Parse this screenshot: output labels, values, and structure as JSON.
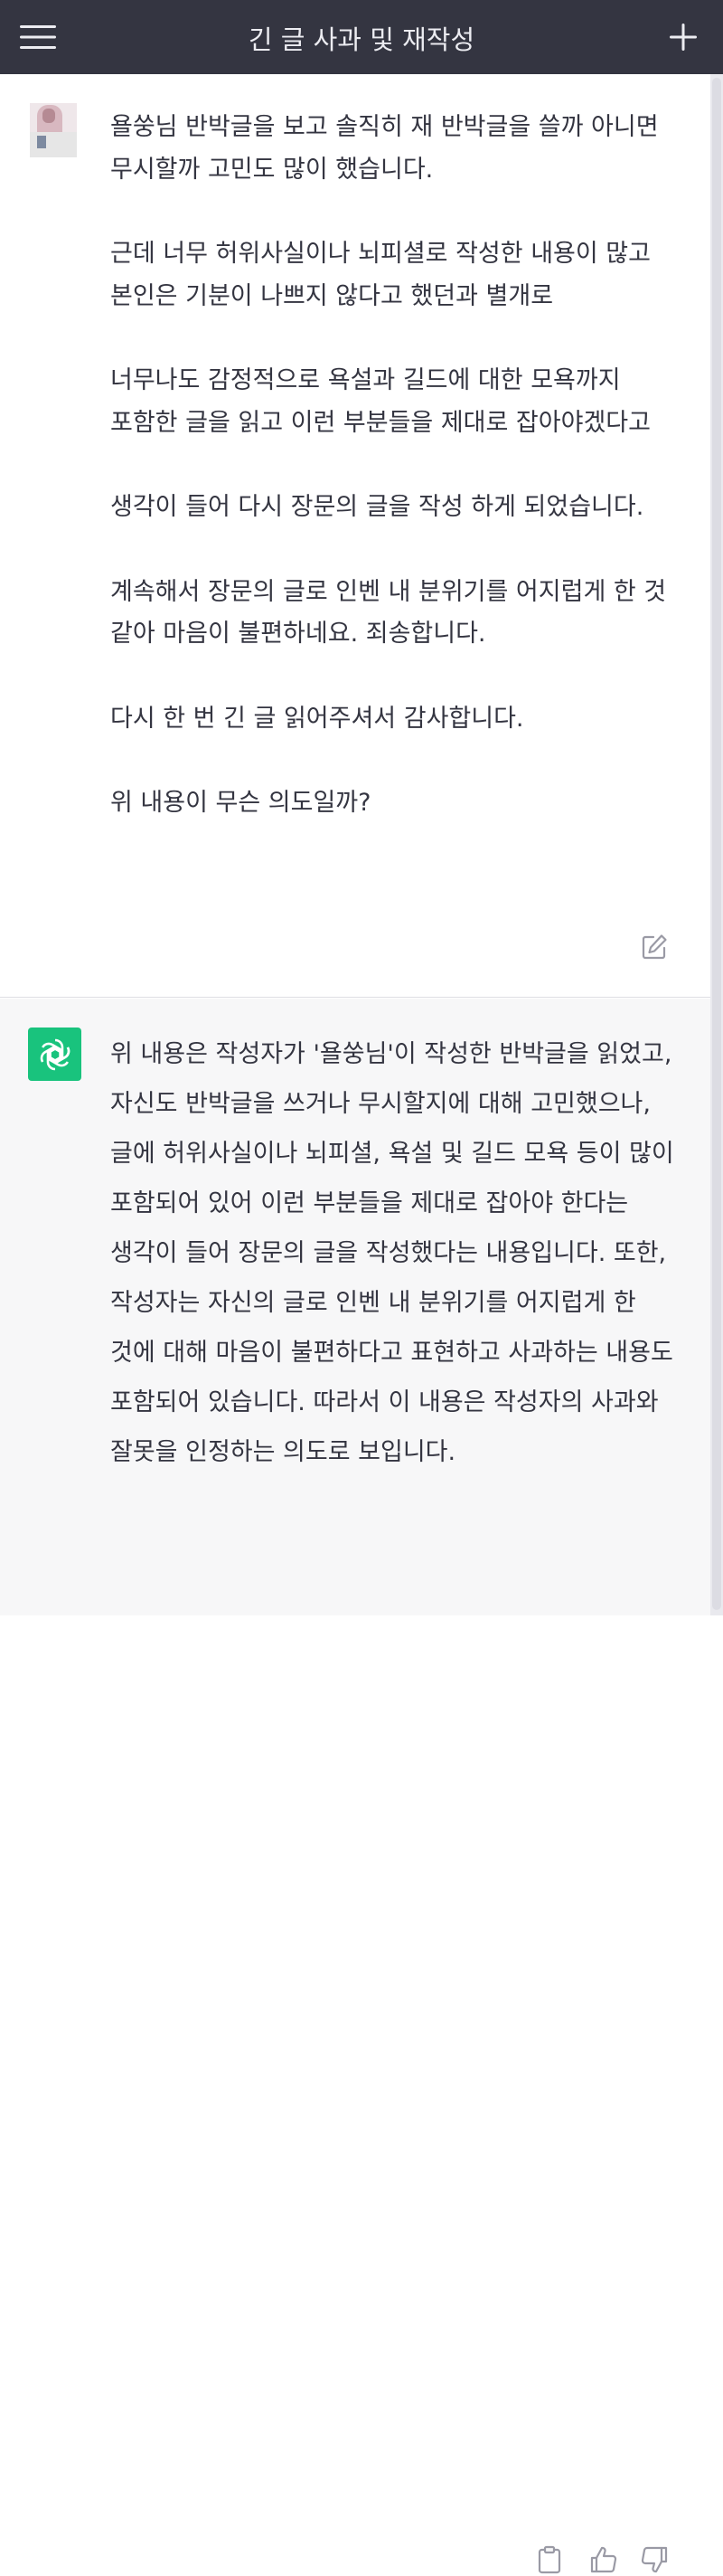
{
  "header": {
    "title": "긴 글 사과 및 재작성",
    "menu_icon": "hamburger-menu-icon",
    "new_chat_icon": "plus-icon"
  },
  "messages": [
    {
      "role": "user",
      "avatar": "user-avatar",
      "text": "욜쑹님 반박글을 보고 솔직히 재 반박글을 쓸까 아니면 무시할까 고민도 많이 했습니다.\n\n근데 너무 허위사실이나 뇌피셜로 작성한 내용이 많고 본인은 기분이 나쁘지 않다고 했던과 별개로\n\n너무나도 감정적으로 욕설과 길드에 대한 모욕까지 포함한 글을 읽고 이런 부분들을 제대로 잡아야겠다고\n\n생각이 들어 다시 장문의 글을 작성 하게 되었습니다.\n\n계속해서 장문의 글로 인벤 내 분위기를 어지럽게 한 것 같아 마음이 불편하네요. 죄송합니다.\n\n다시 한 번 긴 글 읽어주셔서 감사합니다.\n\n위 내용이 무슨 의도일까?",
      "actions": [
        "edit-icon"
      ]
    },
    {
      "role": "assistant",
      "avatar": "openai-logo-icon",
      "text": "위 내용은 작성자가 '욜쑹님'이 작성한 반박글을 읽었고, 자신도 반박글을 쓰거나 무시할지에 대해 고민했으나, 글에 허위사실이나 뇌피셜, 욕설 및 길드 모욕 등이 많이 포함되어 있어 이런 부분들을 제대로 잡아야 한다는 생각이 들어 장문의 글을 작성했다는 내용입니다. 또한, 작성자는 자신의 글로 인벤 내 분위기를 어지럽게 한 것에 대해 마음이 불편하다고 표현하고 사과하는 내용도 포함되어 있습니다. 따라서 이 내용은 작성자의 사과와 잘못을 인정하는 의도로 보입니다.",
      "actions": [
        "clipboard-icon",
        "thumbs-up-icon",
        "thumbs-down-icon"
      ]
    }
  ],
  "colors": {
    "header_bg": "#343541",
    "assistant_bg": "#f7f7f8",
    "bot_avatar": "#19c37d",
    "text": "#343541"
  }
}
